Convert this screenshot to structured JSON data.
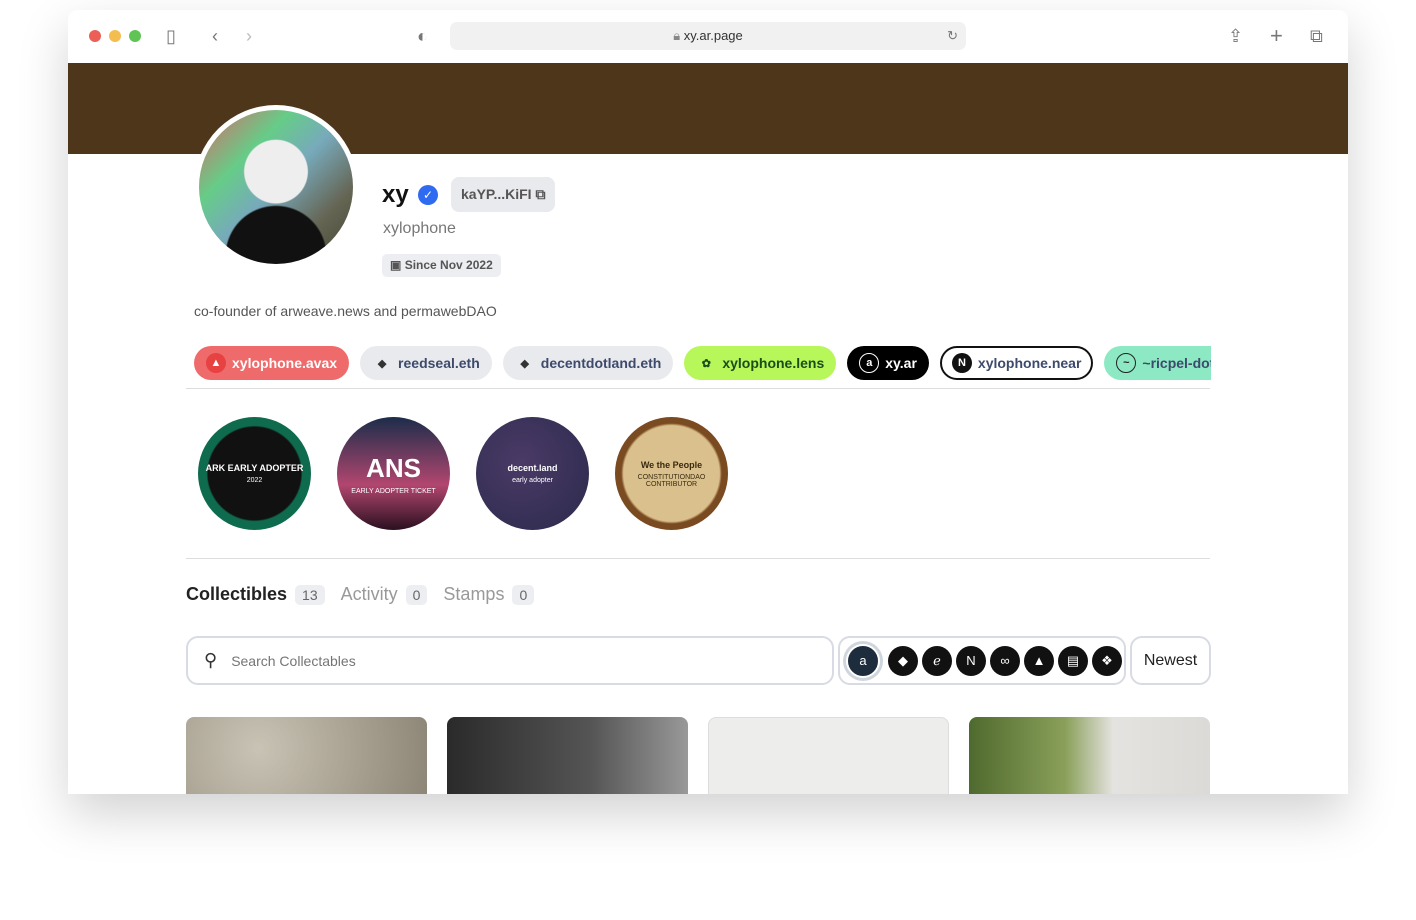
{
  "browser": {
    "url": "xy.ar.page",
    "traffic_colors": [
      "#ec5f57",
      "#f4bd4f",
      "#5fc454"
    ]
  },
  "profile": {
    "name": "xy",
    "address": "kaYP...KiFI",
    "handle": "xylophone",
    "since": "Since Nov 2022",
    "bio": "co-founder of arweave.news and permawebDAO",
    "banner_color": "#4d3619"
  },
  "chips": [
    {
      "label": "xylophone.avax",
      "icon": "avalanche-icon",
      "bg": "#ef6b6b",
      "color": "#ffffff"
    },
    {
      "label": "reedseal.eth",
      "icon": "ethereum-icon",
      "bg": "#e9eaee",
      "color": "#3d4a6b"
    },
    {
      "label": "decentdotland.eth",
      "icon": "ethereum-icon",
      "bg": "#e9eaee",
      "color": "#3d4a6b"
    },
    {
      "label": "xylophone.lens",
      "icon": "lens-icon",
      "bg": "#b8f75a",
      "color": "#1b4d1b"
    },
    {
      "label": "xy.ar",
      "icon": "arweave-icon",
      "bg": "#000000",
      "color": "#ffffff"
    },
    {
      "label": "xylophone.near",
      "icon": "near-icon",
      "bg": "#ffffff",
      "color": "#3d4a6b"
    },
    {
      "label": "~ricpel-dotn",
      "icon": "urbit-icon",
      "bg": "#8ce9c4",
      "color": "#3d4a6b"
    }
  ],
  "badges": [
    {
      "name": "ark-early-adopter",
      "text": "ARK EARLY ADOPTER",
      "sub": "2022"
    },
    {
      "name": "ans-early-adopter",
      "text": "ANS",
      "sub": "EARLY ADOPTER TICKET"
    },
    {
      "name": "decent-land-early-adopter",
      "text": "decent.land",
      "sub": "early adopter"
    },
    {
      "name": "constitutiondao",
      "text": "We the People",
      "sub": "CONSTITUTIONDAO CONTRIBUTOR"
    }
  ],
  "tabs": [
    {
      "label": "Collectibles",
      "count": "13"
    },
    {
      "label": "Activity",
      "count": "0"
    },
    {
      "label": "Stamps",
      "count": "0"
    }
  ],
  "search": {
    "placeholder": "Search Collectables"
  },
  "chains": [
    "arweave",
    "ethereum",
    "everpay",
    "near",
    "polygon",
    "avalanche",
    "fantom",
    "bnb"
  ],
  "sort": "Newest"
}
